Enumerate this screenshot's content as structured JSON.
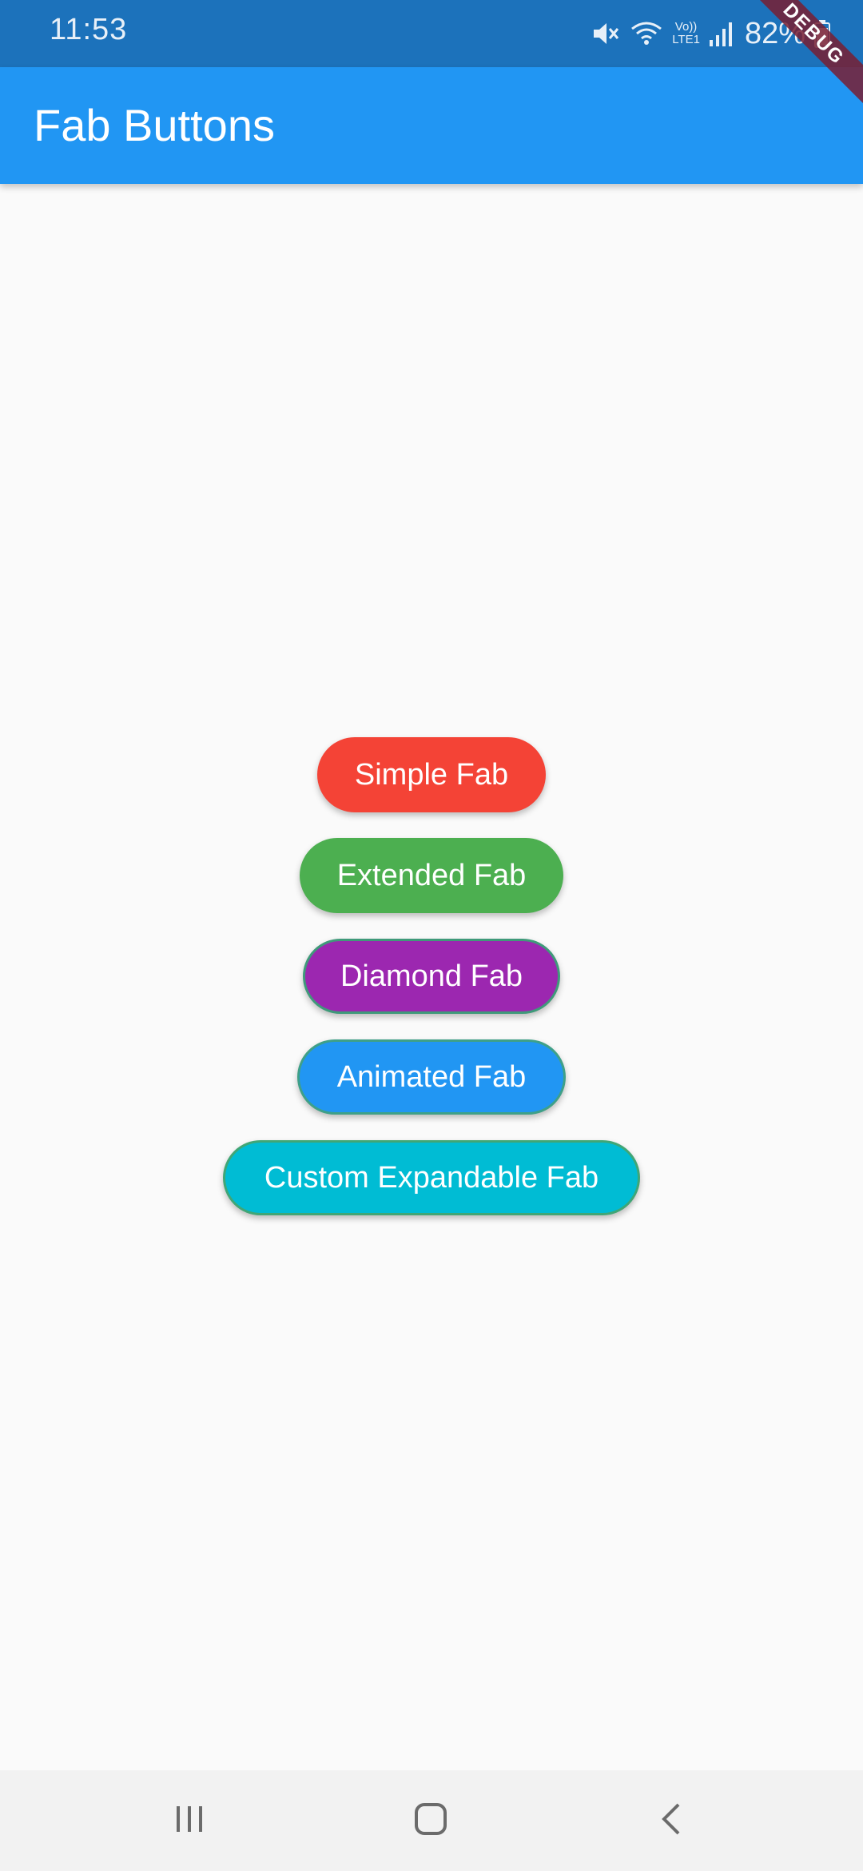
{
  "status_bar": {
    "time": "11:53",
    "battery": "82%",
    "network_label_top": "Vo))",
    "network_label_bottom": "LTE1",
    "icons": [
      "mute-icon",
      "wifi-icon",
      "volte-icon",
      "signal-icon",
      "battery-icon"
    ]
  },
  "app_bar": {
    "title": "Fab Buttons",
    "color": "#2196f3",
    "status_color": "#1c72bb"
  },
  "debug_banner": {
    "label": "DEBUG"
  },
  "buttons": [
    {
      "label": "Simple Fab",
      "color": "#f44336"
    },
    {
      "label": "Extended Fab",
      "color": "#4caf50"
    },
    {
      "label": "Diamond Fab",
      "color": "#9c27b0"
    },
    {
      "label": "Animated Fab",
      "color": "#2196f3"
    },
    {
      "label": "Custom Expandable Fab",
      "color": "#00bcd4"
    }
  ],
  "nav_bar": {
    "icons": [
      "recent-apps-icon",
      "home-icon",
      "back-icon"
    ]
  }
}
